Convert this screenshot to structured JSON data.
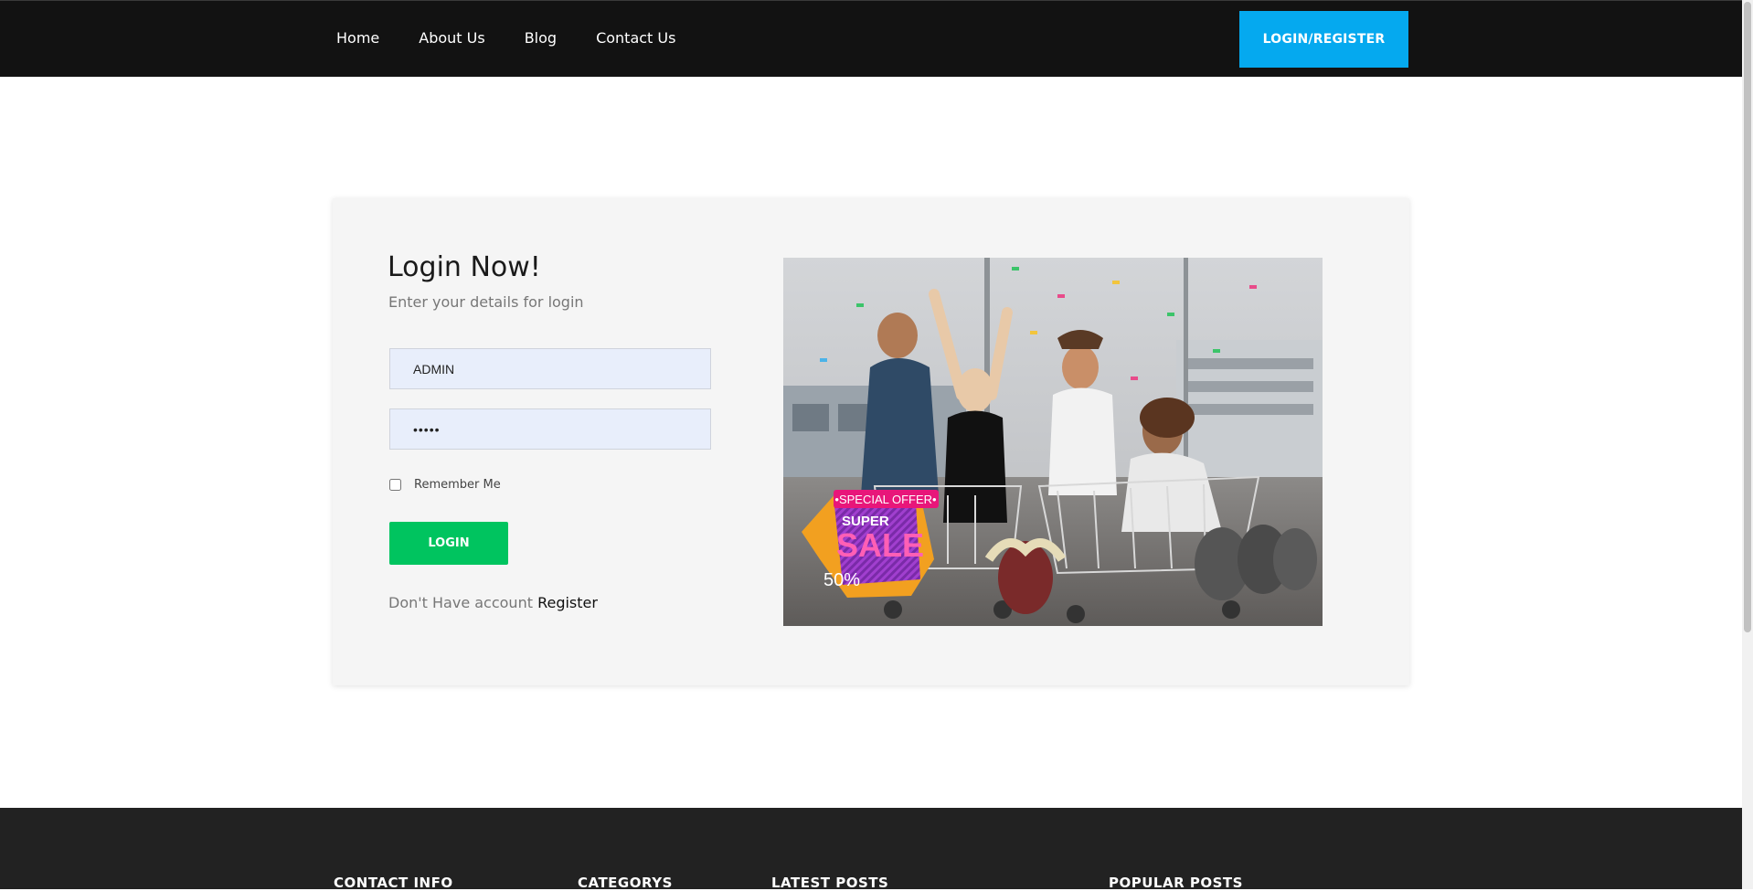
{
  "nav": {
    "links": [
      "Home",
      "About Us",
      "Blog",
      "Contact Us"
    ],
    "login_register_label": "LOGIN/REGISTER"
  },
  "login": {
    "title": "Login Now!",
    "subtitle": "Enter your details for login",
    "username_value": "ADMIN",
    "password_value": "•••••",
    "remember_label": "Remember Me",
    "remember_checked": false,
    "login_button_label": "LOGIN",
    "no_account_text": "Don't Have account",
    "register_link_label": "Register"
  },
  "hero": {
    "badge_top": "•SPECIAL OFFER•",
    "badge_super": "SUPER",
    "badge_sale": "SALE",
    "badge_percent": "50%"
  },
  "footer": {
    "headings": [
      "CONTACT INFO",
      "CATEGORYS",
      "LATEST POSTS",
      "POPULAR POSTS"
    ]
  },
  "colors": {
    "navbar_bg": "#121212",
    "accent_blue": "#05a9ef",
    "login_green": "#00c45f",
    "card_bg": "#f5f5f5",
    "footer_bg": "#222222",
    "input_bg": "#e8eefb"
  }
}
